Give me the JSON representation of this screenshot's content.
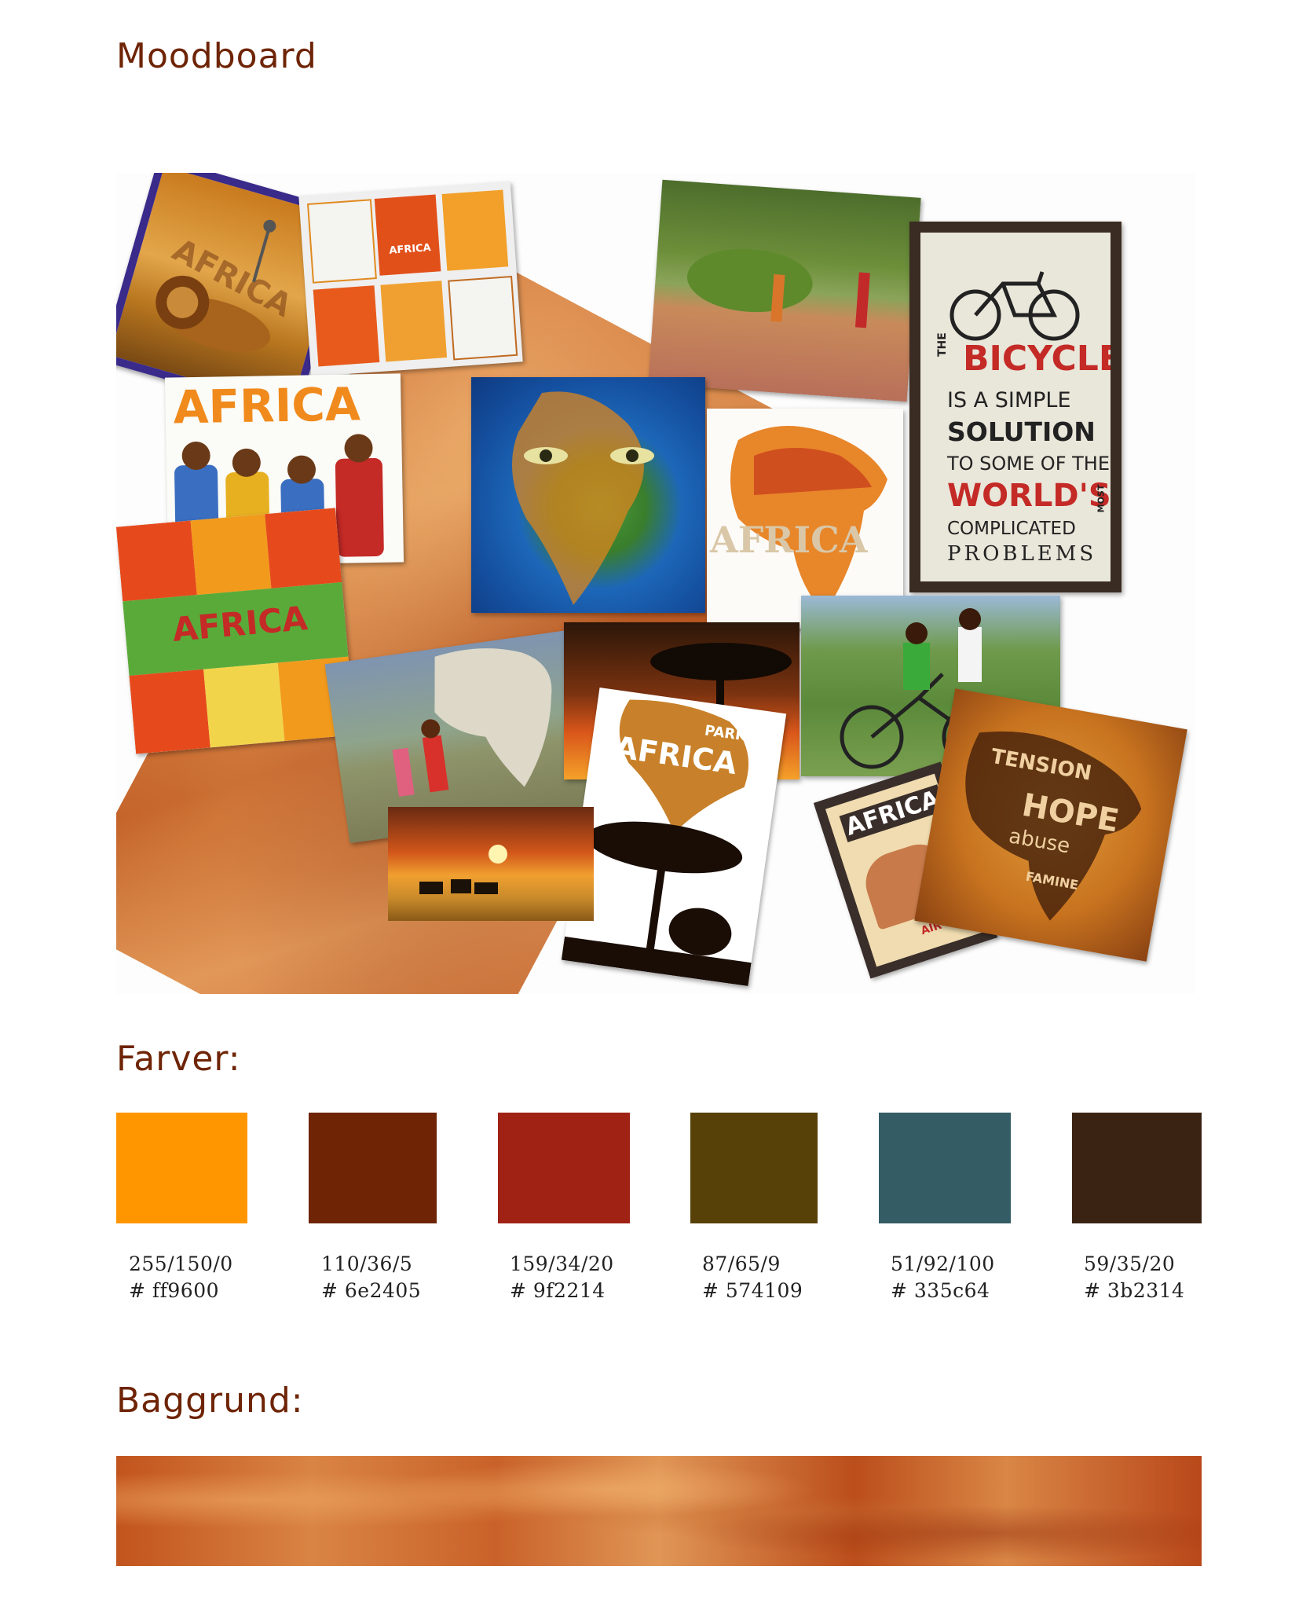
{
  "headings": {
    "moodboard": "Moodboard",
    "colors": "Farver:",
    "background": "Baggrund:"
  },
  "collage": {
    "africa_word": "AFRICA",
    "park_word": "PARK",
    "bicycle_sign": {
      "line1": "THE",
      "line2": "BICYCLE",
      "line3": "IS A SIMPLE",
      "line4": "SOLUTION",
      "line5": "TO SOME OF THE",
      "line6": "WORLD'S",
      "line7": "MOST",
      "line8": "COMPLICATED",
      "line9": "PROBLEMS"
    },
    "hope_word": "HOPE",
    "abuse_word": "abuse",
    "famine_word": "FAMINE",
    "tension_word": "TENSION",
    "air_word": "AIR"
  },
  "swatches": [
    {
      "hex": "#ff9600",
      "rgb": "255/150/0",
      "label": "# ff9600"
    },
    {
      "hex": "#6e2405",
      "rgb": "110/36/5",
      "label": "# 6e2405"
    },
    {
      "hex": "#9f2214",
      "rgb": "159/34/20",
      "label": "# 9f2214"
    },
    {
      "hex": "#574109",
      "rgb": "87/65/9",
      "label": "# 574109"
    },
    {
      "hex": "#335c64",
      "rgb": "51/92/100",
      "label": "# 335c64"
    },
    {
      "hex": "#3b2314",
      "rgb": "59/35/20",
      "label": "# 3b2314"
    }
  ]
}
